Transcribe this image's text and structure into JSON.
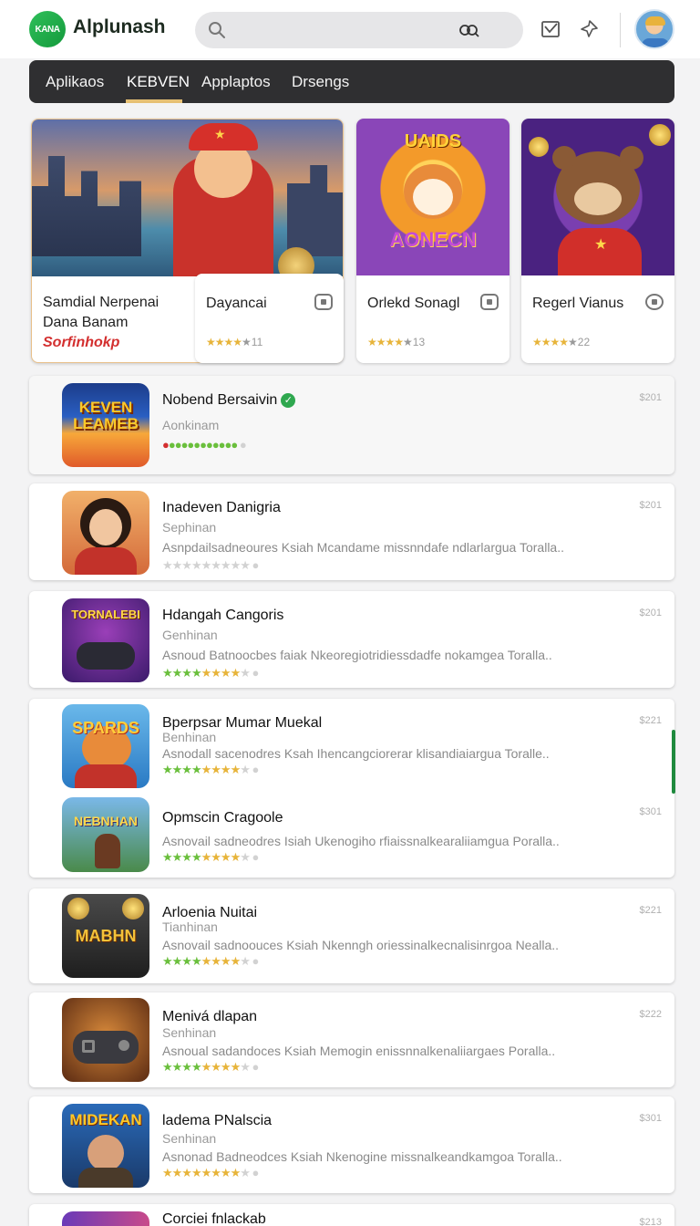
{
  "header": {
    "logo_text": "KANA",
    "brand": "Alplunash",
    "search_placeholder": ""
  },
  "nav": {
    "tabs": [
      {
        "label": "Aplikaos",
        "active": false
      },
      {
        "label": "KEBVEN",
        "active": true
      },
      {
        "label": "Applaptos",
        "active": false
      },
      {
        "label": "Drsengs",
        "active": false
      }
    ],
    "accent": "#e6c074"
  },
  "featured": [
    {
      "title_line1": "Samdial Nerpenai",
      "title_line2": "Dana Banam",
      "promo": "Sorfinhokp",
      "rating_text": ""
    },
    {
      "title_line1": "Dayancai",
      "title_line2": "",
      "promo": "",
      "rating_text": "11"
    },
    {
      "title_line1": "Orlekd Sonagl",
      "title_line2": "",
      "promo": "",
      "rating_text": "13",
      "art_text_1": "UAIDS",
      "art_text_2": "AONECN"
    },
    {
      "title_line1": "Regerl Vianus",
      "title_line2": "",
      "promo": "",
      "rating_text": "22"
    }
  ],
  "apps": [
    {
      "name": "Nobend Bersaivin",
      "category": "Aonkinam",
      "description": "",
      "price": "$201",
      "verified": true,
      "icon_text": "KEVEN LEAMEB"
    },
    {
      "name": "Inadeven Danigria",
      "category": "Sephinan",
      "description": "Asnpdailsadneoures Ksiah Mcandame missnndafe ndlarlargua Toralla..",
      "price": "$201",
      "icon_text": ""
    },
    {
      "name": "Hdangah Cangoris",
      "category": "Genhinan",
      "description": "Asnoud Batnoocbes faiak Nkeoregiotridiessdadfe nokamgea Toralla..",
      "price": "$201",
      "icon_text": "TORNALEBI"
    },
    {
      "name": "Bperpsar Mumar Muekal",
      "category": "Benhinan",
      "description": "Asnodall sacenodres Ksah Ihencangciorerar klisandiaiargua Toralle..",
      "price": "$221",
      "icon_text": "SPARDS"
    },
    {
      "name": "Opmscin Cragoole",
      "category": "",
      "description": "Asnovail sadneodres Isiah Ukenogiho rfiaissnalkearaliiamgua Poralla..",
      "price": "$301",
      "icon_text": "NEBNHAN"
    },
    {
      "name": "Arloenia Nuitai",
      "category": "Tianhinan",
      "description": "Asnovail sadnoouces Ksiah Nkenngh oriessinalkecnalisinrgoa Nealla..",
      "price": "$221",
      "icon_text": "MABHN"
    },
    {
      "name": "Menivá dlapan",
      "category": "Senhinan",
      "description": "Asnoual sadandoces Ksiah Memogin enissnnalkenaliiargaes Poralla..",
      "price": "$222",
      "icon_text": ""
    },
    {
      "name": "ladema PNalscia",
      "category": "Senhinan",
      "description": "Asnonad Badneodces Ksiah Nkenogine missnalkeandkamgoa Toralla..",
      "price": "$301",
      "icon_text": "MIDEKAN"
    },
    {
      "name": "Corciei fnlackab",
      "category": "",
      "description": "",
      "price": "$213",
      "icon_text": ""
    }
  ]
}
